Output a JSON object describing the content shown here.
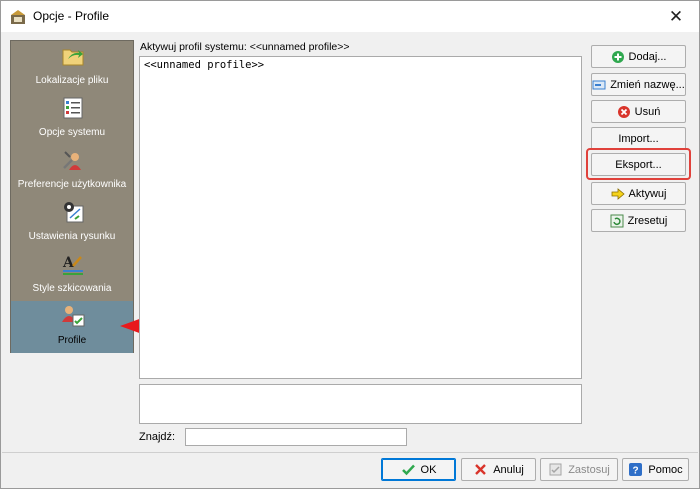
{
  "window": {
    "title": "Opcje - Profile",
    "close_glyph": "✕"
  },
  "sidebar": {
    "items": [
      {
        "label": "Lokalizacje pliku",
        "icon": "folder-arrow-icon"
      },
      {
        "label": "Opcje systemu",
        "icon": "checklist-icon"
      },
      {
        "label": "Preferencje użytkownika",
        "icon": "user-tools-icon"
      },
      {
        "label": "Ustawienia rysunku",
        "icon": "drawing-settings-icon"
      },
      {
        "label": "Style szkicowania",
        "icon": "sketch-style-icon"
      },
      {
        "label": "Profile",
        "icon": "profile-icon",
        "active": true
      }
    ]
  },
  "main": {
    "active_profile_label": "Aktywuj profil systemu:  <<unnamed profile>>",
    "profiles": [
      "<<unnamed profile>>"
    ],
    "find_label": "Znajdź:",
    "find_value": ""
  },
  "actions": {
    "add": "Dodaj...",
    "rename": "Zmień nazwę...",
    "delete": "Usuń",
    "import": "Import...",
    "export": "Eksport...",
    "activate": "Aktywuj",
    "reset": "Zresetuj"
  },
  "footer": {
    "ok": "OK",
    "cancel": "Anuluj",
    "apply": "Zastosuj",
    "help": "Pomoc"
  },
  "colors": {
    "sidebar_bg": "#8f8879",
    "sidebar_active": "#6f8d9c",
    "highlight": "#e0413b",
    "arrow": "#e8191c"
  }
}
